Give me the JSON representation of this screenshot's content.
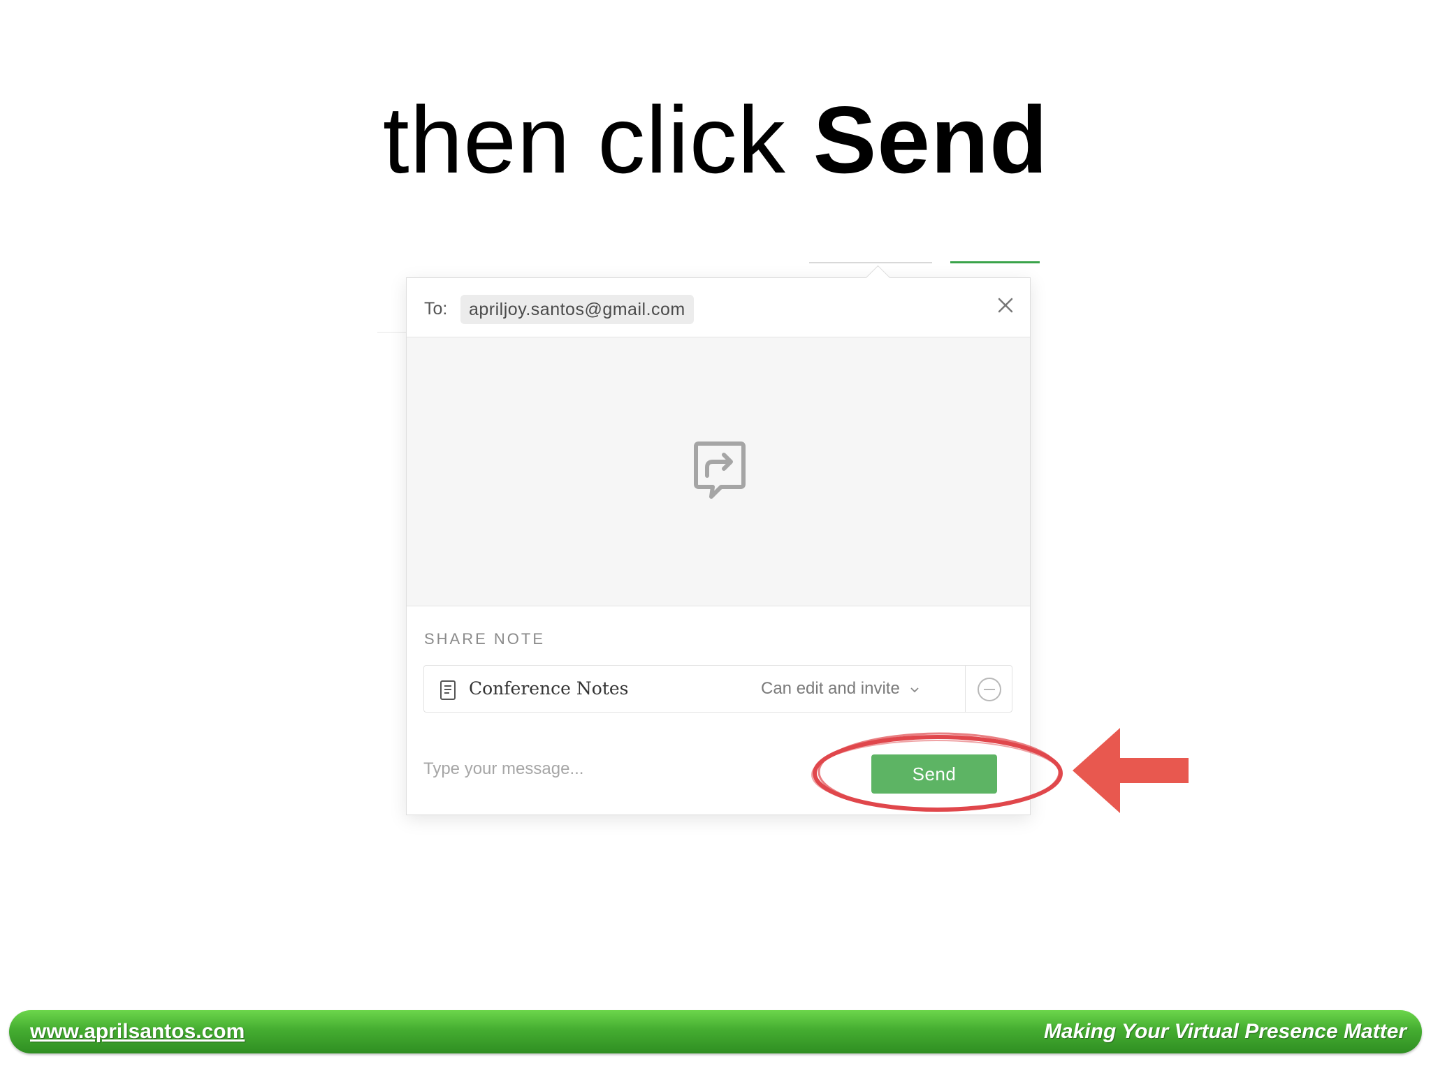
{
  "headline": {
    "plain": "then click",
    "emphasis": "Send"
  },
  "dialog": {
    "to_label": "To:",
    "recipient": "apriljoy.santos@gmail.com",
    "close_icon": "close-icon",
    "preview_icon": "share-note-icon",
    "share_heading": "SHARE NOTE",
    "note": {
      "icon": "note-document-icon",
      "title": "Conference Notes",
      "permission": "Can edit and invite"
    },
    "message_placeholder": "Type your message...",
    "send_label": "Send"
  },
  "annotation": {
    "ring_color": "#e0474c",
    "arrow_color": "#e8584f"
  },
  "footer": {
    "url": "www.aprilsantos.com",
    "tagline": "Making Your Virtual Presence Matter"
  },
  "colors": {
    "send_button": "#5db464",
    "footer_green": "#45ad31"
  }
}
